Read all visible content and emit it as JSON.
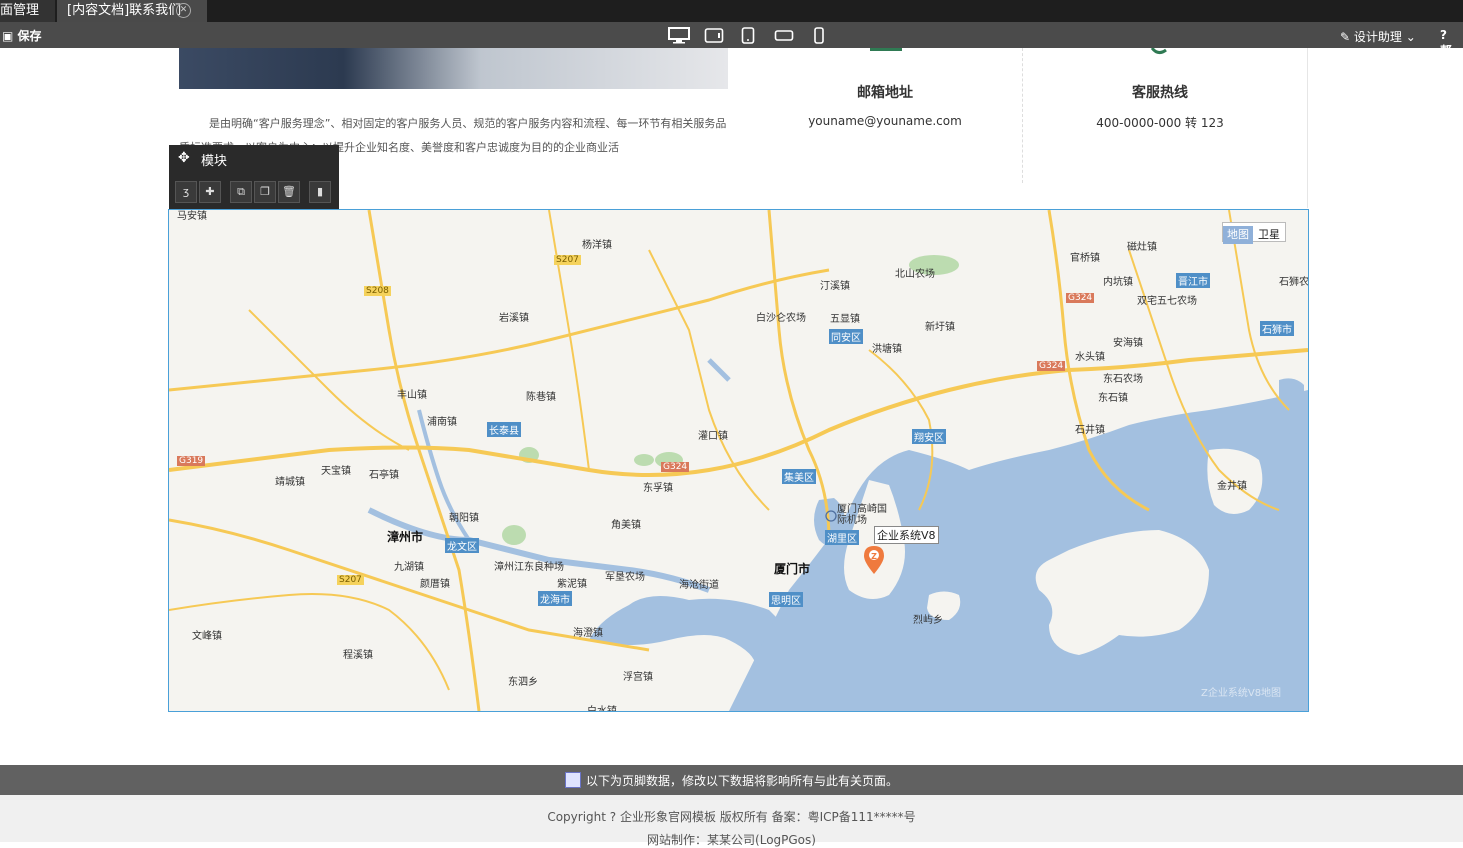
{
  "tabs": [
    {
      "label": "面管理"
    },
    {
      "label": "[内容文档]联系我们"
    }
  ],
  "toolbar": {
    "save_label": "保存",
    "design_help_label": "设计助理",
    "help_label": "帮",
    "devices": [
      "desktop-icon",
      "tablet-landscape-icon",
      "tablet-portrait-icon",
      "phone-landscape-icon",
      "phone-portrait-icon"
    ]
  },
  "content": {
    "intro_text": "是由明确“客户服务理念”、相对固定的客户服务人员、规范的客户服务内容和流程、每一环节有相关服务品质标准要求、以客户为中心；以提升企业知名度、美誉度和客户忠诚度为目的的企业商业活",
    "email_title": "邮箱地址",
    "email_value": "youname@youname.com",
    "hotline_title": "客服热线",
    "hotline_value": "400-0000-000 转 123"
  },
  "module_panel": {
    "label": "模块",
    "tools": [
      "css-icon",
      "plugin-icon",
      "copy-icon",
      "paste-icon",
      "delete-icon",
      "bookmark-icon"
    ]
  },
  "map": {
    "type_buttons": [
      "地图",
      "卫星"
    ],
    "marker_label": "企业系统V8",
    "marker_letter": "Z",
    "watermark": "Z企业系统V8地图",
    "cities": [
      "漳州市",
      "厦门市"
    ],
    "districts": [
      "长泰县",
      "同安区",
      "翔安区",
      "集美区",
      "湖里区",
      "思明区",
      "龙文区",
      "龙海市",
      "晋江市",
      "石狮市"
    ],
    "roads": [
      "G324",
      "G324",
      "G324",
      "G319",
      "S207",
      "S208",
      "S207"
    ],
    "places": [
      "杨洋镇",
      "汀溪镇",
      "北山农场",
      "岩溪镇",
      "白沙仑农场",
      "五显镇",
      "新圩镇",
      "洪塘镇",
      "官桥镇",
      "磁灶镇",
      "内坑镇",
      "双宅五七农场",
      "安海镇",
      "水头镇",
      "东石农场",
      "东石镇",
      "石井镇",
      "金井镇",
      "丰山镇",
      "陈巷镇",
      "浦南镇",
      "灌口镇",
      "天宝镇",
      "石亭镇",
      "靖城镇",
      "东孚镇",
      "朝阳镇",
      "角美镇",
      "九湖镇",
      "颜厝镇",
      "漳州江东良种场",
      "紫泥镇",
      "军垦农场",
      "海沧街道",
      "厦门高崎国际机场",
      "烈屿乡",
      "文峰镇",
      "程溪镇",
      "海澄镇",
      "东泗乡",
      "浮宫镇",
      "白水镇",
      "马安镇",
      "石狮农"
    ]
  },
  "footer": {
    "notice": "以下为页脚数据，修改以下数据将影响所有与此有关页面。",
    "copyright": "Copyright ? 企业形象官网模板 版权所有 备案：粤ICP备111*****号",
    "credit": "网站制作：某某公司(LogPGos)"
  },
  "colors": {
    "map_water": "#a3c0e0",
    "map_land": "#f5f4f0",
    "road_yellow": "#f6c955",
    "district_blue": "#4f8fc7",
    "marker": "#ef7a3e"
  }
}
